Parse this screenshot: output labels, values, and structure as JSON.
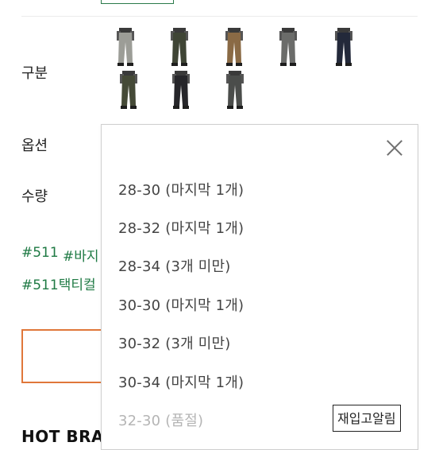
{
  "labels": {
    "category": "구분",
    "option": "옵션",
    "quantity": "수량"
  },
  "swatches": [
    {
      "name": "gray",
      "color": "#9c9d97",
      "selected": false
    },
    {
      "name": "ranger-green",
      "color": "#3f4535",
      "selected": false
    },
    {
      "name": "coyote",
      "color": "#8a6a45",
      "selected": false
    },
    {
      "name": "storm",
      "color": "#6b6c6a",
      "selected": true
    },
    {
      "name": "dark-navy",
      "color": "#23293a",
      "selected": false
    },
    {
      "name": "tundra",
      "color": "#454a37",
      "selected": false
    },
    {
      "name": "black",
      "color": "#26262a",
      "selected": false
    },
    {
      "name": "volcanic",
      "color": "#4b4d4b",
      "selected": false
    }
  ],
  "tags": [
    "#511",
    "#바지",
    "#511택티컬"
  ],
  "dropdown": {
    "options": [
      {
        "label": "28-30 (마지막 1개)",
        "soldout": false
      },
      {
        "label": "28-32 (마지막 1개)",
        "soldout": false
      },
      {
        "label": "28-34 (3개 미만)",
        "soldout": false
      },
      {
        "label": "30-30 (마지막 1개)",
        "soldout": false
      },
      {
        "label": "30-32 (3개 미만)",
        "soldout": false
      },
      {
        "label": "30-34 (마지막 1개)",
        "soldout": false
      },
      {
        "label": "32-30 (품절)",
        "soldout": true
      }
    ],
    "restock_label": "재입고알림"
  },
  "section_title": "HOT BRA",
  "colors": {
    "accent_green": "#1f7a44",
    "cart_border": "#e0773a"
  }
}
